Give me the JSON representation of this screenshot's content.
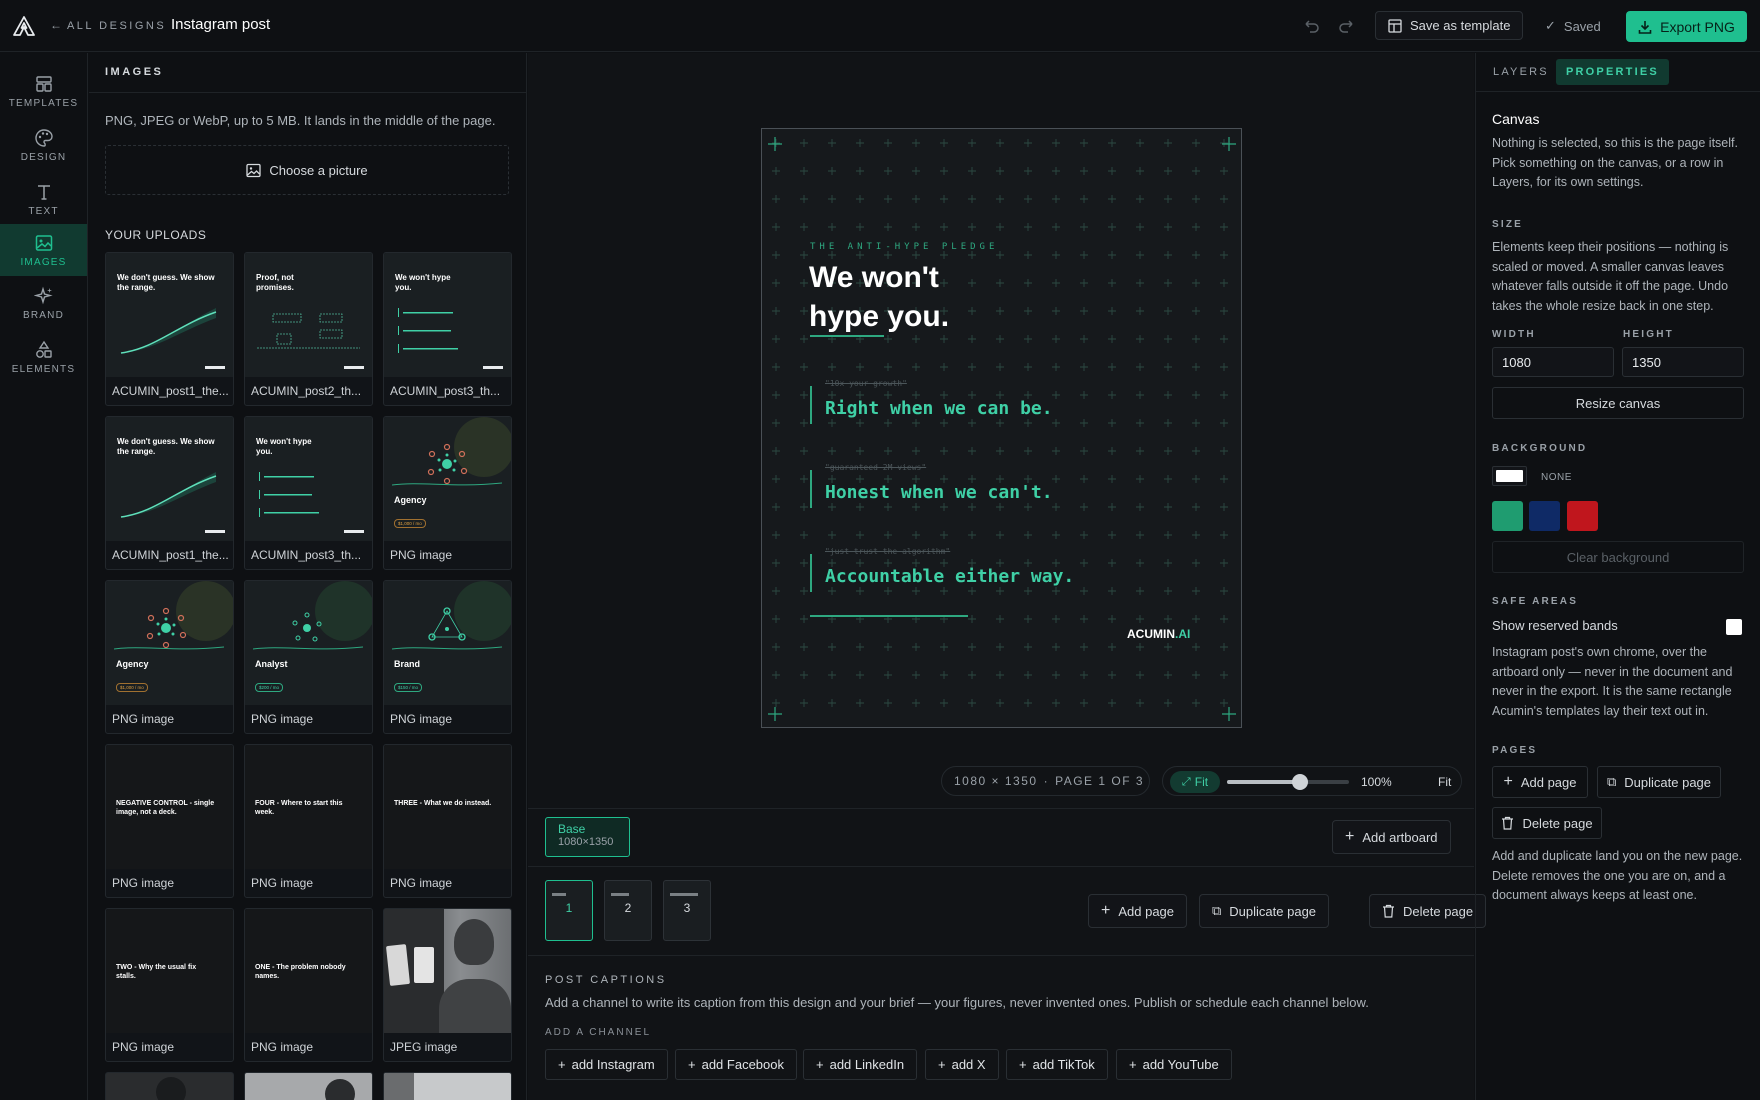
{
  "topbar": {
    "back_label": "ALL DESIGNS",
    "title": "Instagram post",
    "save_template": "Save as template",
    "saved": "Saved",
    "export": "Export PNG"
  },
  "rail": {
    "items": [
      {
        "label": "TEMPLATES",
        "icon": "templates-icon"
      },
      {
        "label": "DESIGN",
        "icon": "palette-icon"
      },
      {
        "label": "TEXT",
        "icon": "text-icon"
      },
      {
        "label": "IMAGES",
        "icon": "image-icon",
        "active": true
      },
      {
        "label": "BRAND",
        "icon": "sparkle-icon"
      },
      {
        "label": "ELEMENTS",
        "icon": "shapes-icon"
      }
    ]
  },
  "images_panel": {
    "heading": "IMAGES",
    "description": "PNG, JPEG or WebP, up to 5 MB. It lands in the middle of the page.",
    "choose": "Choose a picture",
    "uploads_heading": "YOUR UPLOADS",
    "uploads": [
      {
        "name": "ACUMIN_post1_the...",
        "headline": "We don't guess. We show the range."
      },
      {
        "name": "ACUMIN_post2_th...",
        "headline": "Proof, not promises."
      },
      {
        "name": "ACUMIN_post3_th...",
        "headline": "We won't hype you."
      },
      {
        "name": "ACUMIN_post1_the...",
        "headline": "We don't guess. We show the range."
      },
      {
        "name": "ACUMIN_post3_th...",
        "headline": "We won't hype you."
      },
      {
        "name": "PNG image",
        "headline": "Agency",
        "tag": "$1,000 / mo"
      },
      {
        "name": "PNG image",
        "headline": "Agency",
        "tag": "$1,000 / mo"
      },
      {
        "name": "PNG image",
        "headline": "Analyst",
        "tag": "$200 / mo"
      },
      {
        "name": "PNG image",
        "headline": "Brand",
        "tag": "$150 / mo"
      },
      {
        "name": "PNG image",
        "headline": "NEGATIVE CONTROL - single image, not a deck."
      },
      {
        "name": "PNG image",
        "headline": "FOUR - Where to start this week."
      },
      {
        "name": "PNG image",
        "headline": "THREE - What we do instead."
      },
      {
        "name": "PNG image",
        "headline": "TWO - Why the usual fix stalls."
      },
      {
        "name": "PNG image",
        "headline": "ONE - The problem nobody names."
      },
      {
        "name": "JPEG image",
        "headline": ""
      }
    ]
  },
  "artboard": {
    "kicker": "THE ANTI-HYPE PLEDGE",
    "headline1": "We won't",
    "headline2": "hype you.",
    "strike1": "\"10x your growth\"",
    "line1": "Right when we can be.",
    "strike2": "\"guaranteed 2M views\"",
    "line2": "Honest when we can't.",
    "strike3": "\"just trust the algorithm\"",
    "line3": "Accountable either way.",
    "brand": "ACUMIN",
    "brand_suffix": ".AI"
  },
  "zoom": {
    "dims": "1080 × 1350",
    "page_info": "PAGE 1 OF 3",
    "fit": "Fit",
    "percent": "100%",
    "fit2": "Fit",
    "level": 0.6
  },
  "artboards": {
    "base_label": "Base",
    "base_size": "1080×1350",
    "add_artboard": "Add artboard"
  },
  "pages": {
    "thumbs": [
      "1",
      "2",
      "3"
    ],
    "add": "Add page",
    "duplicate": "Duplicate page",
    "delete": "Delete page"
  },
  "captions": {
    "heading": "POST CAPTIONS",
    "description": "Add a channel to write its caption from this design and your brief — your figures, never invented ones. Publish or schedule each channel below.",
    "add_channel": "ADD A CHANNEL",
    "channels": [
      "add Instagram",
      "add Facebook",
      "add LinkedIn",
      "add X",
      "add TikTok",
      "add YouTube"
    ]
  },
  "properties": {
    "tab_layers": "LAYERS",
    "tab_properties": "PROPERTIES",
    "canvas_title": "Canvas",
    "canvas_desc": "Nothing is selected, so this is the page itself. Pick something on the canvas, or a row in Layers, for its own settings.",
    "size_heading": "SIZE",
    "size_desc": "Elements keep their positions — nothing is scaled or moved. A smaller canvas leaves whatever falls outside it off the page. Undo takes the whole resize back in one step.",
    "width_label": "WIDTH",
    "height_label": "HEIGHT",
    "width": "1080",
    "height": "1350",
    "resize": "Resize canvas",
    "bg_heading": "BACKGROUND",
    "bg_none": "NONE",
    "swatches": [
      "#1f9c70",
      "#0f2a66",
      "#c0161d"
    ],
    "clear_bg": "Clear background",
    "safe_heading": "SAFE AREAS",
    "safe_label": "Show reserved bands",
    "safe_desc": "Instagram post's own chrome, over the artboard only — never in the document and never in the export. It is the same rectangle Acumin's templates lay their text out in.",
    "pages_heading": "PAGES",
    "add_page": "Add page",
    "dup_page": "Duplicate page",
    "del_page": "Delete page",
    "pages_desc": "Add and duplicate land you on the new page. Delete removes the one you are on, and a document always keeps at least one."
  },
  "colors": {
    "accent": "#1fbf8f",
    "accent_text": "#3fd0a6"
  }
}
